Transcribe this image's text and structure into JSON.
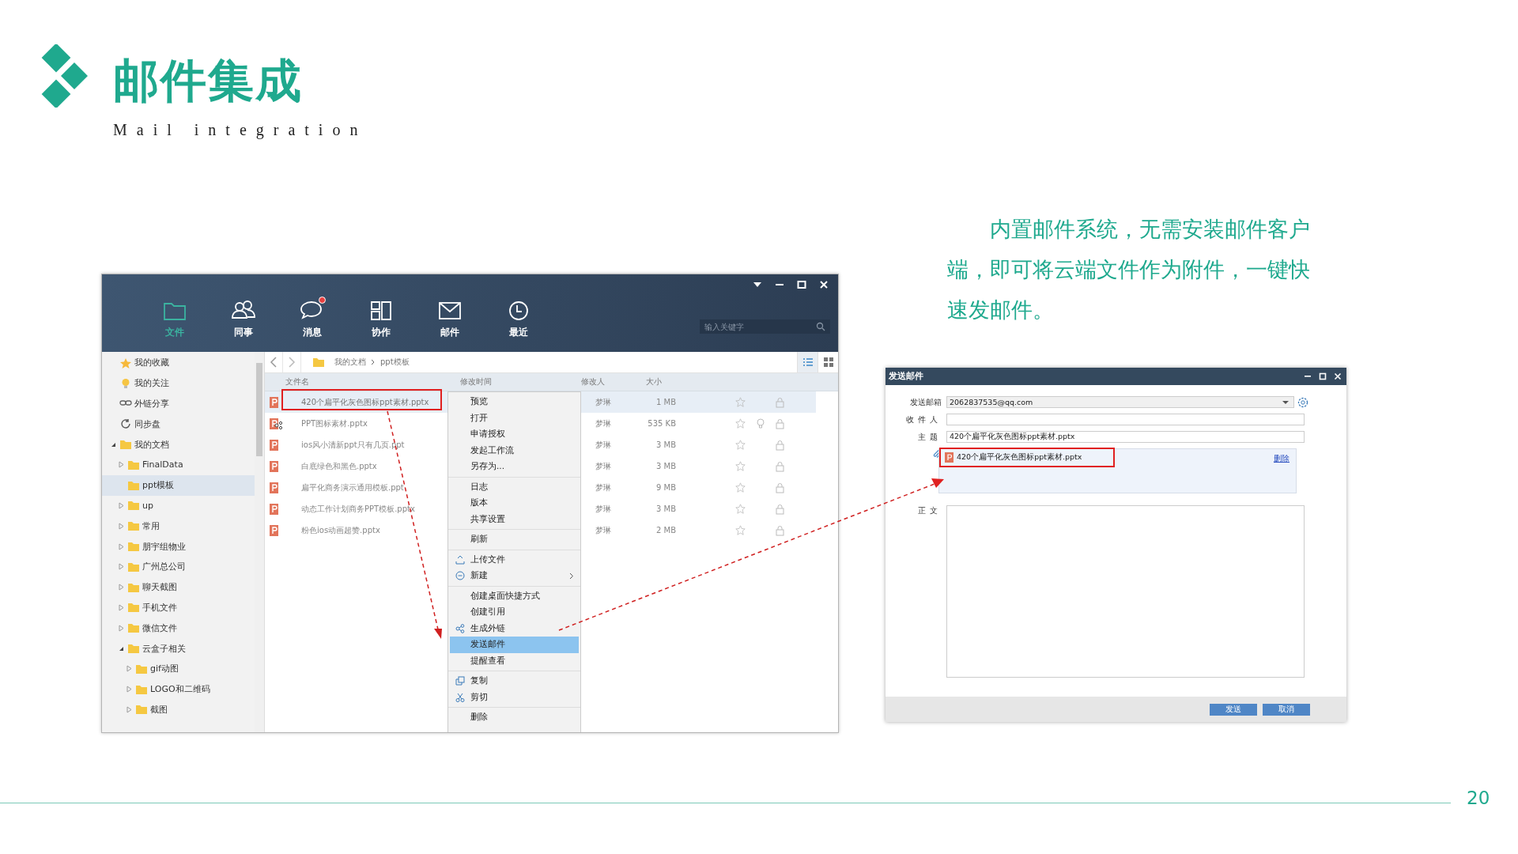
{
  "title": "邮件集成",
  "subtitle": "Mail integration",
  "description": "内置邮件系统，无需安装邮件客户端，即可将云端文件作为附件，一键快速发邮件。",
  "app": {
    "nav": [
      {
        "label": "文件",
        "kind": "folder",
        "selected": true,
        "notification": false
      },
      {
        "label": "同事",
        "kind": "people",
        "selected": false,
        "notification": false
      },
      {
        "label": "消息",
        "kind": "chat",
        "selected": false,
        "notification": true
      },
      {
        "label": "协作",
        "kind": "collab",
        "selected": false,
        "notification": false
      },
      {
        "label": "邮件",
        "kind": "mail",
        "selected": false,
        "notification": false
      },
      {
        "label": "最近",
        "kind": "clock",
        "selected": false,
        "notification": false
      }
    ],
    "search": {
      "placeholder": "输入关键字"
    },
    "sidebar": [
      {
        "label": "我的收藏",
        "kind": "star",
        "selected": false
      },
      {
        "label": "我的关注",
        "kind": "bulb",
        "selected": false
      },
      {
        "label": "外链分享",
        "kind": "link",
        "selected": false
      },
      {
        "label": "同步盘",
        "kind": "sync",
        "selected": false
      },
      {
        "label": "我的文档",
        "kind": "folder",
        "expanded": true,
        "selected": false,
        "children": [
          {
            "label": "FinalData",
            "kind": "folder",
            "expanded": false,
            "selected": false
          },
          {
            "label": "ppt模板",
            "kind": "folder",
            "selected": true
          },
          {
            "label": "up",
            "kind": "folder",
            "expanded": false,
            "selected": false
          },
          {
            "label": "常用",
            "kind": "folder",
            "expanded": false,
            "selected": false
          },
          {
            "label": "朋宇组物业",
            "kind": "folder",
            "expanded": false,
            "selected": false
          },
          {
            "label": "广州总公司",
            "kind": "folder",
            "expanded": false,
            "selected": false
          },
          {
            "label": "聊天截图",
            "kind": "folder",
            "expanded": false,
            "selected": false
          },
          {
            "label": "手机文件",
            "kind": "folder",
            "expanded": false,
            "selected": false
          },
          {
            "label": "微信文件",
            "kind": "folder",
            "expanded": false,
            "selected": false
          },
          {
            "label": "云盒子相关",
            "kind": "folder",
            "expanded": true,
            "selected": false,
            "children": [
              {
                "label": "gif动图",
                "kind": "folder",
                "expanded": false,
                "selected": false
              },
              {
                "label": "LOGO和二维码",
                "kind": "folder",
                "expanded": false,
                "selected": false
              },
              {
                "label": "截图",
                "kind": "folder",
                "expanded": false,
                "selected": false
              }
            ]
          }
        ]
      }
    ],
    "breadcrumb": [
      "我的文档",
      "ppt模板"
    ],
    "view_modes": [
      {
        "kind": "list",
        "selected": true
      },
      {
        "kind": "grid",
        "selected": false
      }
    ],
    "columns": [
      "文件名",
      "修改时间",
      "修改人",
      "大小"
    ],
    "files": [
      {
        "name": "420个扁平化灰色图标ppt素材.pptx",
        "modifier": "梦琳",
        "size": "1 MB",
        "selected": true,
        "shared": false,
        "watched": false
      },
      {
        "name": "PPT图标素材.pptx",
        "modifier": "梦琳",
        "size": "535 KB",
        "selected": false,
        "shared": true,
        "watched": true
      },
      {
        "name": "ios风小清新ppt只有几页.ppt",
        "modifier": "梦琳",
        "size": "3 MB",
        "selected": false,
        "shared": false,
        "watched": false
      },
      {
        "name": "白底绿色和黑色.pptx",
        "modifier": "梦琳",
        "size": "3 MB",
        "selected": false,
        "shared": false,
        "watched": false
      },
      {
        "name": "扁平化商务演示通用模板.ppt",
        "modifier": "梦琳",
        "size": "9 MB",
        "selected": false,
        "shared": false,
        "watched": false
      },
      {
        "name": "动态工作计划商务PPT模板.pptx",
        "modifier": "梦琳",
        "size": "3 MB",
        "selected": false,
        "shared": false,
        "watched": false
      },
      {
        "name": "粉色ios动画超赞.pptx",
        "modifier": "梦琳",
        "size": "2 MB",
        "selected": false,
        "shared": false,
        "watched": false
      }
    ],
    "context_menu": [
      {
        "items": [
          {
            "label": "预览",
            "kind": "plain",
            "selected": false,
            "submenu": false
          },
          {
            "label": "打开",
            "kind": "plain",
            "selected": false,
            "submenu": false
          },
          {
            "label": "申请授权",
            "kind": "plain",
            "selected": false,
            "submenu": false
          },
          {
            "label": "发起工作流",
            "kind": "plain",
            "selected": false,
            "submenu": false
          },
          {
            "label": "另存为...",
            "kind": "plain",
            "selected": false,
            "submenu": false
          }
        ]
      },
      {
        "items": [
          {
            "label": "日志",
            "kind": "plain",
            "selected": false,
            "submenu": false
          },
          {
            "label": "版本",
            "kind": "plain",
            "selected": false,
            "submenu": false
          },
          {
            "label": "共享设置",
            "kind": "plain",
            "selected": false,
            "submenu": false
          }
        ]
      },
      {
        "items": [
          {
            "label": "刷新",
            "kind": "plain",
            "selected": false,
            "submenu": false
          }
        ]
      },
      {
        "items": [
          {
            "label": "上传文件",
            "kind": "upload",
            "selected": false,
            "submenu": false
          },
          {
            "label": "新建",
            "kind": "new",
            "selected": false,
            "submenu": true
          }
        ]
      },
      {
        "items": [
          {
            "label": "创建桌面快捷方式",
            "kind": "plain",
            "selected": false,
            "submenu": false
          },
          {
            "label": "创建引用",
            "kind": "plain",
            "selected": false,
            "submenu": false
          },
          {
            "label": "生成外链",
            "kind": "share",
            "selected": false,
            "submenu": false
          },
          {
            "label": "发送邮件",
            "kind": "plain",
            "selected": true,
            "submenu": false
          },
          {
            "label": "提醒查看",
            "kind": "plain",
            "selected": false,
            "submenu": false
          }
        ]
      },
      {
        "items": [
          {
            "label": "复制",
            "kind": "copy",
            "selected": false,
            "submenu": false
          },
          {
            "label": "剪切",
            "kind": "cut",
            "selected": false,
            "submenu": false
          }
        ]
      },
      {
        "items": [
          {
            "label": "删除",
            "kind": "plain",
            "selected": false,
            "submenu": false
          }
        ]
      }
    ]
  },
  "dialog": {
    "title": "发送邮件",
    "sender": {
      "label": "发送邮箱",
      "value": "2062837535@qq.com"
    },
    "recipient": {
      "label": "收件人"
    },
    "subject": {
      "label": "主题",
      "value": "420个扁平化灰色图标ppt素材.pptx"
    },
    "attachment": {
      "name": "420个扁平化灰色图标ppt素材.pptx",
      "action": "删除"
    },
    "body": {
      "label": "正文"
    },
    "buttons": [
      "发送",
      "取消"
    ]
  },
  "page_number": "20"
}
